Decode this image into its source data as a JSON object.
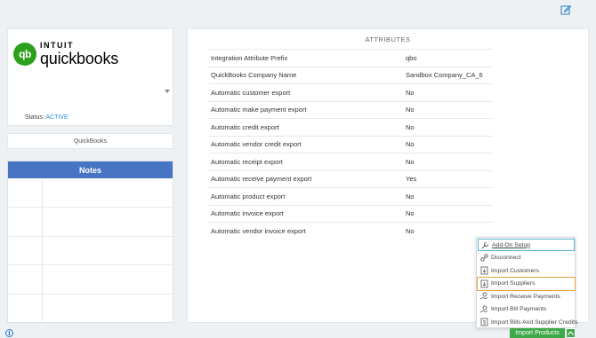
{
  "connection": {
    "logo_brand": "INTUIT",
    "logo_product": "quickbooks",
    "logo_mark": "qb",
    "status_label": "Status:",
    "status_value": "ACTIVE",
    "name": "QuickBooks"
  },
  "notes": {
    "title": "Notes",
    "row_count": 5
  },
  "attributes": {
    "title": "ATTRIBUTES",
    "rows": [
      {
        "label": "Integration Attribute Prefix",
        "value": "qbo"
      },
      {
        "label": "QuickBooks Company Name",
        "value": "Sandbox Company_CA_6"
      },
      {
        "label": "Automatic customer export",
        "value": "No"
      },
      {
        "label": "Automatic make payment export",
        "value": "No"
      },
      {
        "label": "Automatic credit export",
        "value": "No"
      },
      {
        "label": "Automatic vendor credit export",
        "value": "No"
      },
      {
        "label": "Automatic receipt export",
        "value": "No"
      },
      {
        "label": "Automatic receive payment export",
        "value": "Yes"
      },
      {
        "label": "Automatic product export",
        "value": "No"
      },
      {
        "label": "Automatic invoice export",
        "value": "No"
      },
      {
        "label": "Automatic vendor invoice export",
        "value": "No"
      }
    ]
  },
  "menu": {
    "items": [
      {
        "label": "Add-On Setup",
        "icon": "wrench-icon"
      },
      {
        "label": "Disconnect",
        "icon": "unlink-icon"
      },
      {
        "label": "Import Customers",
        "icon": "document-import-icon"
      },
      {
        "label": "Import Suppliers",
        "icon": "document-import-icon"
      },
      {
        "label": "Import Receive Payments",
        "icon": "hand-money-icon"
      },
      {
        "label": "Import Bill Payments",
        "icon": "hand-money-icon"
      },
      {
        "label": "Import Bills And Supplier Credits",
        "icon": "document-dollar-icon"
      }
    ]
  },
  "footer": {
    "import_button": "Import Products"
  },
  "colors": {
    "brand_green": "#2ca01c",
    "notes_header": "#4874c4",
    "status_active": "#2b8fd6",
    "import_button": "#3fa94a",
    "highlight": "#e3a23a"
  }
}
